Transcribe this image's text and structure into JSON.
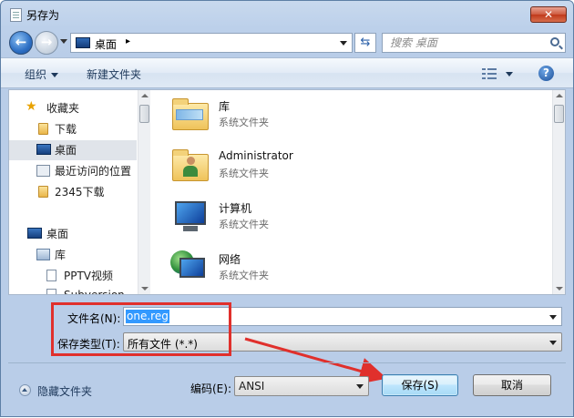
{
  "window": {
    "title": "另存为",
    "close_glyph": "✕"
  },
  "address_bar": {
    "path": "桌面",
    "path_separator": "▸",
    "search_placeholder": "搜索 桌面"
  },
  "toolbar": {
    "organize_label": "组织",
    "new_folder_label": "新建文件夹",
    "help_glyph": "?"
  },
  "nav_pane": {
    "items": [
      {
        "label": "收藏夹",
        "icon": "star-icon"
      },
      {
        "label": "下载",
        "icon": "folder-icon"
      },
      {
        "label": "桌面",
        "icon": "desktop-icon",
        "selected": true
      },
      {
        "label": "最近访问的位置",
        "icon": "recent-places-icon"
      },
      {
        "label": "2345下载",
        "icon": "folder-icon"
      },
      {
        "label": "桌面",
        "icon": "desktop-icon"
      },
      {
        "label": "库",
        "icon": "library-icon"
      },
      {
        "label": "PPTV视频",
        "icon": "document-icon"
      },
      {
        "label": "Subversion",
        "icon": "document-icon"
      }
    ]
  },
  "file_pane": {
    "items": [
      {
        "name": "库",
        "type": "系统文件夹",
        "icon": "library-folder-icon"
      },
      {
        "name": "Administrator",
        "type": "系统文件夹",
        "icon": "user-folder-icon"
      },
      {
        "name": "计算机",
        "type": "系统文件夹",
        "icon": "computer-icon"
      },
      {
        "name": "网络",
        "type": "系统文件夹",
        "icon": "network-icon"
      }
    ]
  },
  "form": {
    "filename_label": "文件名(N):",
    "filename_value": "one.reg",
    "filetype_label": "保存类型(T):",
    "filetype_value": "所有文件 (*.*)",
    "encoding_label": "编码(E):",
    "encoding_value": "ANSI"
  },
  "footer": {
    "hide_folders_label": "隐藏文件夹",
    "save_label": "保存(S)",
    "cancel_label": "取消"
  },
  "annotation_colors": {
    "highlight": "#e0302c"
  }
}
